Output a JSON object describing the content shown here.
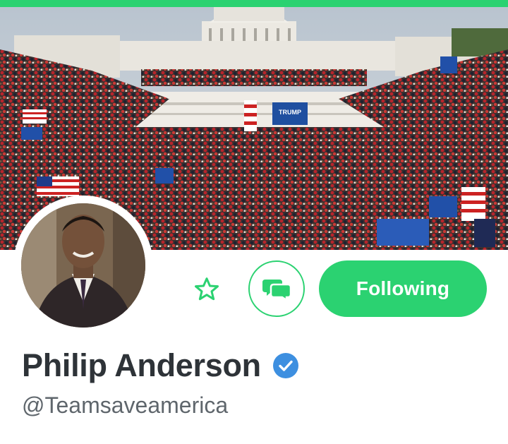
{
  "colors": {
    "accent": "#2bd271",
    "verified": "#3d8fe0",
    "name_text": "#2e3338",
    "handle_text": "#5f666c"
  },
  "banner": {
    "image": "crowd-at-capitol-photo",
    "sign_text": "TRUMP"
  },
  "profile": {
    "avatar": "profile-photo",
    "display_name": "Philip Anderson",
    "verified_icon": "verified-badge-icon",
    "handle": "@Teamsaveamerica"
  },
  "actions": {
    "favorite_icon": "star-icon",
    "message_icon": "chat-bubbles-icon",
    "follow_label": "Following"
  }
}
